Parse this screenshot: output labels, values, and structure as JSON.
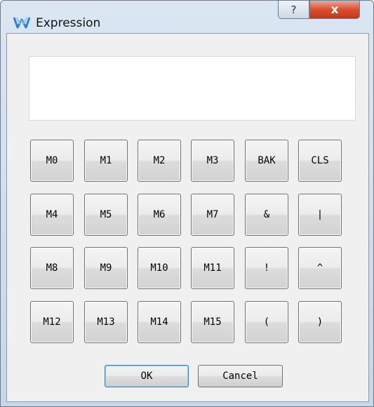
{
  "window": {
    "title": "Expression",
    "help_label": "?",
    "close_label": "x"
  },
  "display": {
    "value": ""
  },
  "keypad": {
    "rows": [
      [
        "M0",
        "M1",
        "M2",
        "M3",
        "BAK",
        "CLS"
      ],
      [
        "M4",
        "M5",
        "M6",
        "M7",
        "&",
        "|"
      ],
      [
        "M8",
        "M9",
        "M10",
        "M11",
        "!",
        "^"
      ],
      [
        "M12",
        "M13",
        "M14",
        "M15",
        "(",
        ")"
      ]
    ]
  },
  "actions": {
    "ok_label": "OK",
    "cancel_label": "Cancel"
  },
  "colors": {
    "close_red": "#d9502f",
    "ok_focus": "#3c7fb1",
    "dialog_bg": "#f0f0f0"
  }
}
